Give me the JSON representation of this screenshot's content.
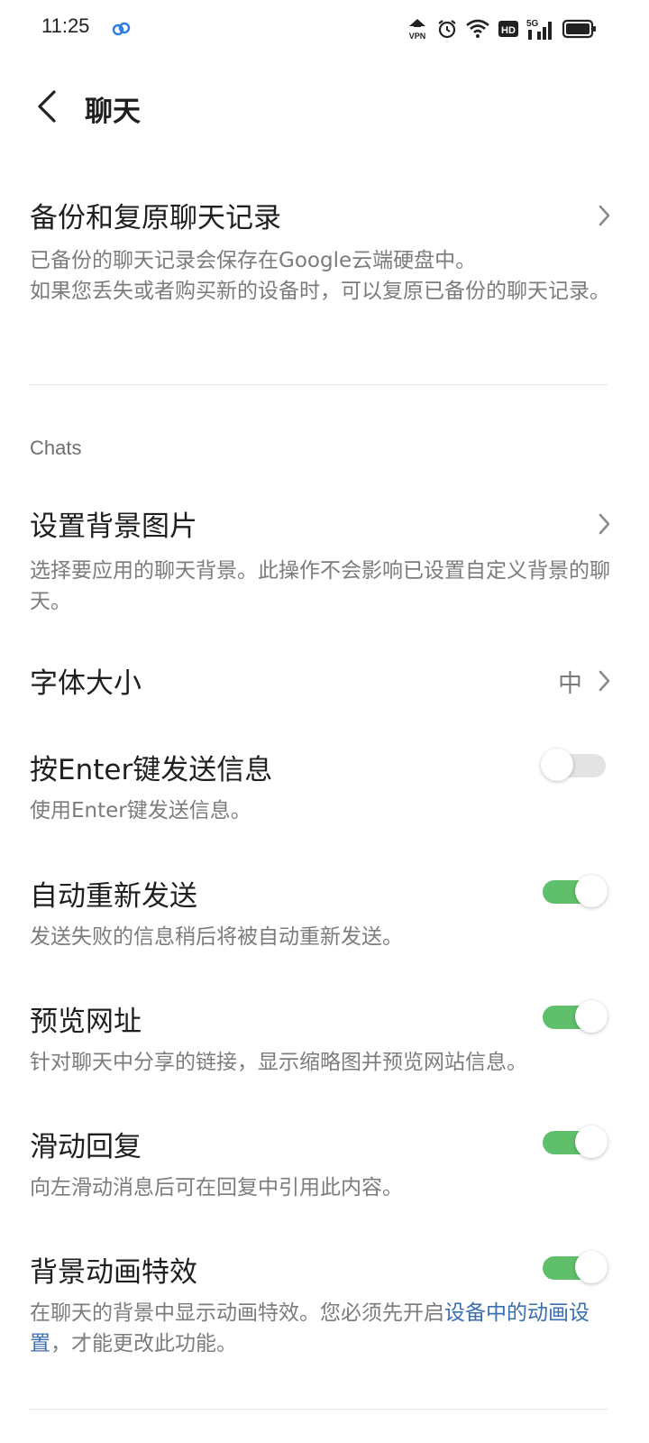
{
  "status_bar": {
    "time": "11:25",
    "icons": [
      "cloud-sync-icon",
      "vpn-icon",
      "alarm-icon",
      "wifi-icon",
      "hd-icon",
      "5g-signal-icon",
      "battery-icon"
    ],
    "vpn_label": "VPN",
    "hd_label": "HD",
    "network_label": "5G"
  },
  "header": {
    "title": "聊天",
    "back_icon": "chevron-left-icon"
  },
  "backup": {
    "title": "备份和复原聊天记录",
    "subtitle": "已备份的聊天记录会保存在Google云端硬盘中。\n如果您丢失或者购买新的设备时，可以复原已备份的聊天记录。"
  },
  "chats_section": {
    "label": "Chats"
  },
  "settings": {
    "background": {
      "title": "设置背景图片",
      "subtitle": "选择要应用的聊天背景。此操作不会影响已设置自定义背景的聊天。"
    },
    "font_size": {
      "title": "字体大小",
      "value": "中"
    },
    "enter_send": {
      "title": "按Enter键发送信息",
      "subtitle": "使用Enter键发送信息。",
      "enabled": false
    },
    "auto_resend": {
      "title": "自动重新发送",
      "subtitle": "发送失败的信息稍后将被自动重新发送。",
      "enabled": true
    },
    "url_preview": {
      "title": "预览网址",
      "subtitle": "针对聊天中分享的链接，显示缩略图并预览网站信息。",
      "enabled": true
    },
    "swipe_reply": {
      "title": "滑动回复",
      "subtitle": "向左滑动消息后可在回复中引用此内容。",
      "enabled": true
    },
    "bg_animation": {
      "title": "背景动画特效",
      "subtitle_before": "在聊天的背景中显示动画特效。您必须先开启",
      "subtitle_link": "设备中的动画设置",
      "subtitle_after": "，才能更改此功能。",
      "enabled": true
    }
  },
  "colors": {
    "toggle_on": "#5fbf6a",
    "toggle_off": "#e3e3e3",
    "link": "#3b6fb0",
    "subtitle": "#7c7c7c"
  }
}
